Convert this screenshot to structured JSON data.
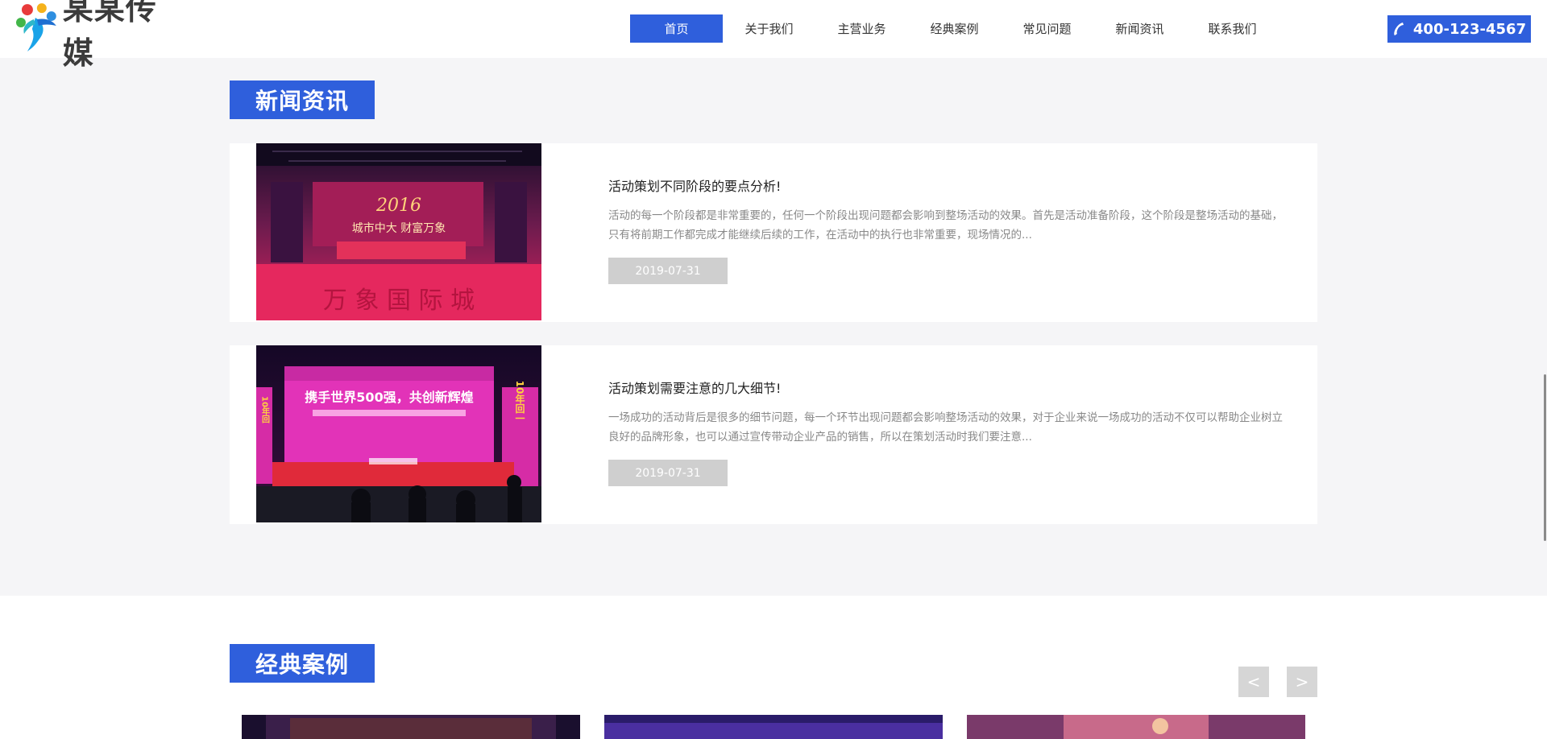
{
  "header": {
    "brand": "某某传媒",
    "nav": [
      {
        "label": "首页",
        "active": true
      },
      {
        "label": "关于我们"
      },
      {
        "label": "主营业务"
      },
      {
        "label": "经典案例"
      },
      {
        "label": "常见问题"
      },
      {
        "label": "新闻资讯"
      },
      {
        "label": "联系我们"
      }
    ],
    "phone": "400-123-4567"
  },
  "news": {
    "title": "新闻资讯",
    "items": [
      {
        "title": "活动策划不同阶段的要点分析!",
        "desc": "活动的每一个阶段都是非常重要的，任何一个阶段出现问题都会影响到整场活动的效果。首先是活动准备阶段，这个阶段是整场活动的基础，只有将前期工作都完成才能继续后续的工作，在活动中的执行也非常重要，现场情况的...",
        "date": "2019-07-31",
        "image_text": {
          "year": "2016",
          "slogan": "城市中大  财富万象",
          "banner": "万 象 国 际 城"
        }
      },
      {
        "title": "活动策划需要注意的几大细节!",
        "desc": "一场成功的活动背后是很多的细节问题，每一个环节出现问题都会影响整场活动的效果，对于企业来说一场成功的活动不仅可以帮助企业树立良好的品牌形象，也可以通过宣传带动企业产品的销售，所以在策划活动时我们要注意...",
        "date": "2019-07-31",
        "image_text": {
          "headline": "携手世界500强，共创新辉煌",
          "side_left": "10年回",
          "side_right": "10年回一"
        }
      }
    ]
  },
  "cases": {
    "title": "经典案例",
    "prev": "<",
    "next": ">"
  },
  "colors": {
    "accent": "#2f5fdc",
    "section_bg": "#f5f5f7",
    "date_bg": "#cfcfcf"
  },
  "icons": [
    "logo-mark-icon",
    "phone-icon"
  ]
}
